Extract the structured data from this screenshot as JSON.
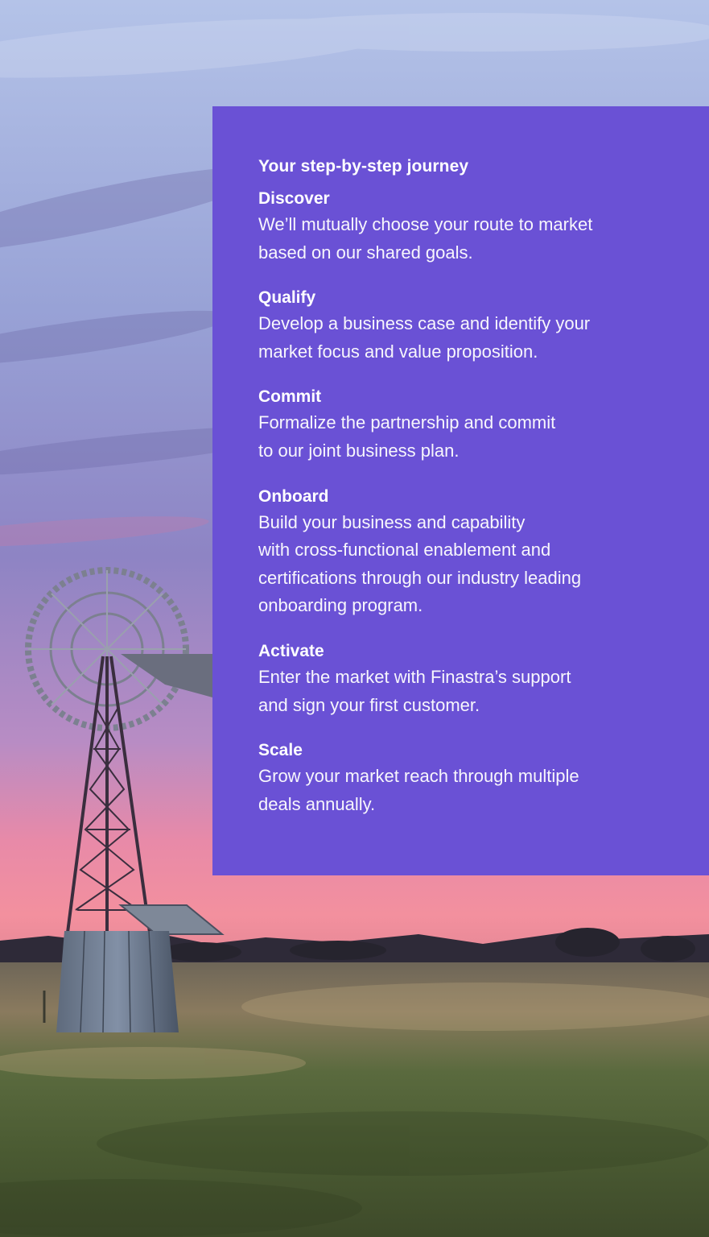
{
  "journey": {
    "title": "Your step-by-step journey",
    "steps": [
      {
        "title": "Discover",
        "text": "We’ll mutually choose your route to market\nbased on our shared goals."
      },
      {
        "title": "Qualify",
        "text": "Develop a business case and identify your\nmarket focus and value proposition."
      },
      {
        "title": "Commit",
        "text": "Formalize the partnership and commit\nto our joint business plan."
      },
      {
        "title": "Onboard",
        "text": "Build your business and capability\nwith cross-functional enablement and\ncertifications through our industry leading\nonboarding program."
      },
      {
        "title": "Activate",
        "text": "Enter the market with Finastra’s support\nand sign your first customer."
      },
      {
        "title": "Scale",
        "text": "Grow your market reach through multiple\ndeals annually."
      }
    ]
  },
  "colors": {
    "panel": "#6a51d5",
    "sky_top": "#aebee4",
    "sky_mid": "#8b84c4",
    "horizon_pink": "#f08aa0",
    "grass": "#4a5a34"
  }
}
